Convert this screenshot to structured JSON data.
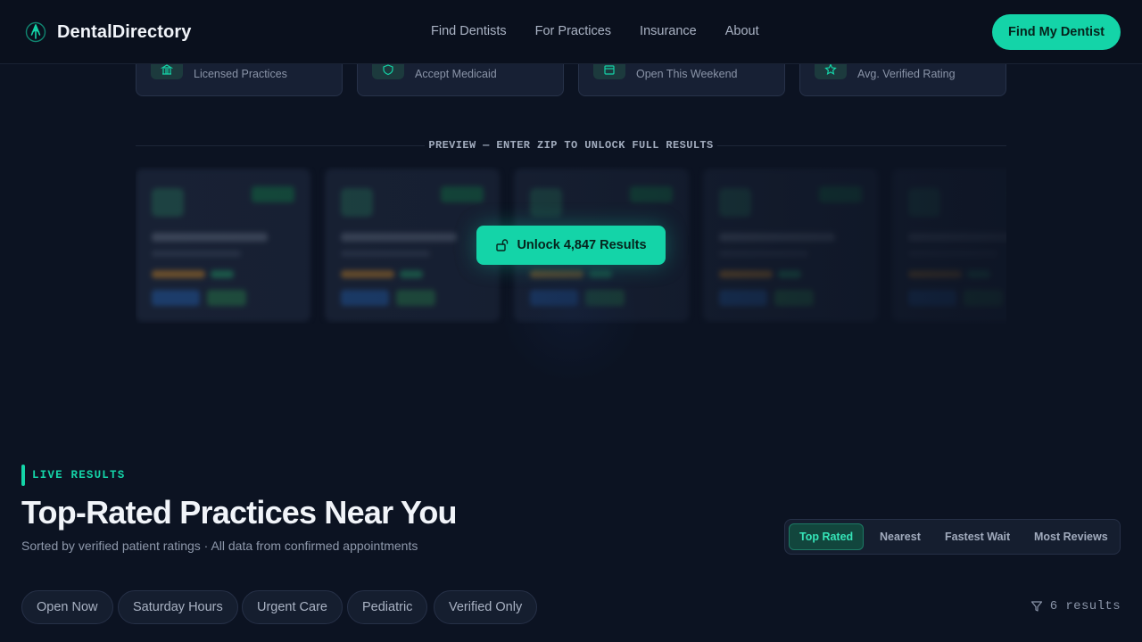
{
  "nav": {
    "brand": "DentalDirectory",
    "links": [
      "Find Dentists",
      "For Practices",
      "Insurance",
      "About"
    ],
    "cta": "Find My Dentist"
  },
  "stats": [
    {
      "label": "Licensed Practices",
      "icon": "building-icon"
    },
    {
      "label": "Accept Medicaid",
      "icon": "shield-icon"
    },
    {
      "label": "Open This Weekend",
      "icon": "calendar-icon"
    },
    {
      "label": "Avg. Verified Rating",
      "icon": "star-icon"
    }
  ],
  "preview": {
    "label": "PREVIEW — ENTER ZIP TO UNLOCK FULL RESULTS",
    "unlock": "Unlock 4,847 Results"
  },
  "results": {
    "live_label": "LIVE RESULTS",
    "title": "Top-Rated Practices Near You",
    "subtitle": "Sorted by verified patient ratings · All data from confirmed appointments",
    "sort_options": [
      "Top Rated",
      "Nearest",
      "Fastest Wait",
      "Most Reviews"
    ],
    "active_sort": "Top Rated",
    "filters": [
      "Open Now",
      "Saturday Hours",
      "Urgent Care",
      "Pediatric",
      "Verified Only"
    ],
    "count": "6 results"
  },
  "colors": {
    "accent": "#14d4a8",
    "background": "#0c1322",
    "card": "#172034"
  }
}
